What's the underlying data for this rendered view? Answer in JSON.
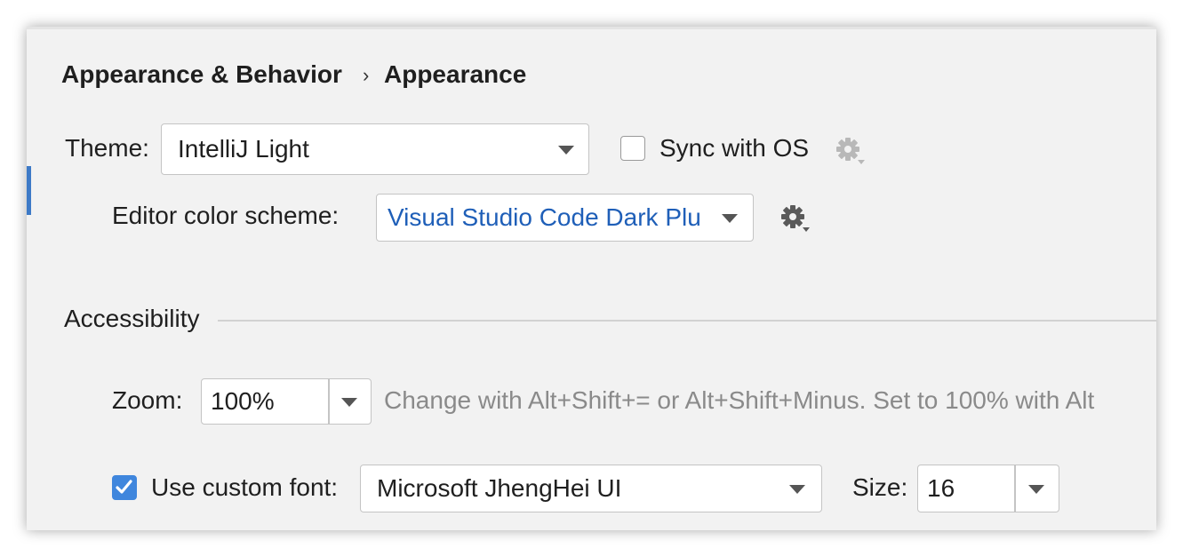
{
  "breadcrumb": {
    "parent": "Appearance & Behavior",
    "separator": "›",
    "current": "Appearance"
  },
  "theme": {
    "label": "Theme:",
    "value": "IntelliJ Light",
    "sync_label": "Sync with OS",
    "sync_checked": false
  },
  "editor_scheme": {
    "label": "Editor color scheme:",
    "value": "Visual Studio Code Dark Plu"
  },
  "accessibility": {
    "heading": "Accessibility"
  },
  "zoom": {
    "label": "Zoom:",
    "value": "100%",
    "hint": "Change with Alt+Shift+= or Alt+Shift+Minus. Set to 100% with Alt"
  },
  "custom_font": {
    "label": "Use custom font:",
    "checked": true,
    "value": "Microsoft JhengHei UI",
    "size_label": "Size:",
    "size_value": "16"
  },
  "icons": {
    "sync_settings": "gear-icon",
    "scheme_settings": "gear-icon",
    "dropdown": "chevron-down-icon",
    "check": "checkmark-icon"
  },
  "colors": {
    "accent": "#3d7ac7",
    "link_value": "#1f5fb8",
    "checkbox_checked": "#3f86dd",
    "hint_text": "#8a8a8a",
    "panel_bg": "#f2f2f2"
  }
}
